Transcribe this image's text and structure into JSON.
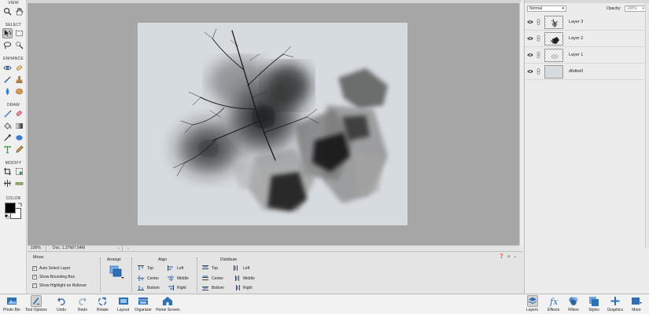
{
  "tools": {
    "sections": [
      "VIEW",
      "SELECT",
      "ENHANCE",
      "DRAW",
      "MODIFY",
      "COLOR"
    ]
  },
  "colors": {
    "accent": "#2f6fb5",
    "canvas_bg": "#a6a6a6",
    "document_bg": "#d6dbe0",
    "foreground": "#000000",
    "background": "#ffffff"
  },
  "status": {
    "zoom": "100%",
    "doc": "Doc: 1.37M/7.54M"
  },
  "options": {
    "title": "Move",
    "checkboxes": [
      {
        "label": "Auto Select Layer",
        "checked": true
      },
      {
        "label": "Show Bounding Box",
        "checked": true
      },
      {
        "label": "Show Highlight on Rollover",
        "checked": true
      }
    ],
    "arrange_label": "Arrange",
    "align_label": "Align",
    "align": {
      "top": "Top",
      "center": "Center",
      "bottom": "Bottom",
      "left": "Left",
      "middle": "Middle",
      "right": "Right"
    },
    "distribute_label": "Distribute",
    "distribute": {
      "top": "Top",
      "center": "Center",
      "bottom": "Bottom",
      "left": "Left",
      "middle": "Middle",
      "right": "Right"
    }
  },
  "layers_panel": {
    "blend_mode": "Normal",
    "opacity_label": "Opacity:",
    "opacity": "100%",
    "layers": [
      {
        "name": "Layer 3"
      },
      {
        "name": "Layer 2"
      },
      {
        "name": "Layer 1"
      },
      {
        "name": "d6dbe0"
      }
    ]
  },
  "bottom_bar": {
    "left": [
      {
        "label": "Photo Bin",
        "icon": "photo-bin-icon"
      },
      {
        "label": "Tool Options",
        "icon": "tool-options-icon"
      },
      {
        "label": "Undo",
        "icon": "undo-icon"
      },
      {
        "label": "Redo",
        "icon": "redo-icon"
      },
      {
        "label": "Rotate",
        "icon": "rotate-icon"
      },
      {
        "label": "Layout",
        "icon": "layout-icon"
      },
      {
        "label": "Organizer",
        "icon": "organizer-icon"
      },
      {
        "label": "Home Screen",
        "icon": "home-icon"
      }
    ],
    "right": [
      {
        "label": "Layers",
        "icon": "layers-icon"
      },
      {
        "label": "Effects",
        "icon": "effects-icon"
      },
      {
        "label": "Filters",
        "icon": "filters-icon"
      },
      {
        "label": "Styles",
        "icon": "styles-icon"
      },
      {
        "label": "Graphics",
        "icon": "graphics-icon"
      },
      {
        "label": "More",
        "icon": "more-icon"
      }
    ]
  }
}
